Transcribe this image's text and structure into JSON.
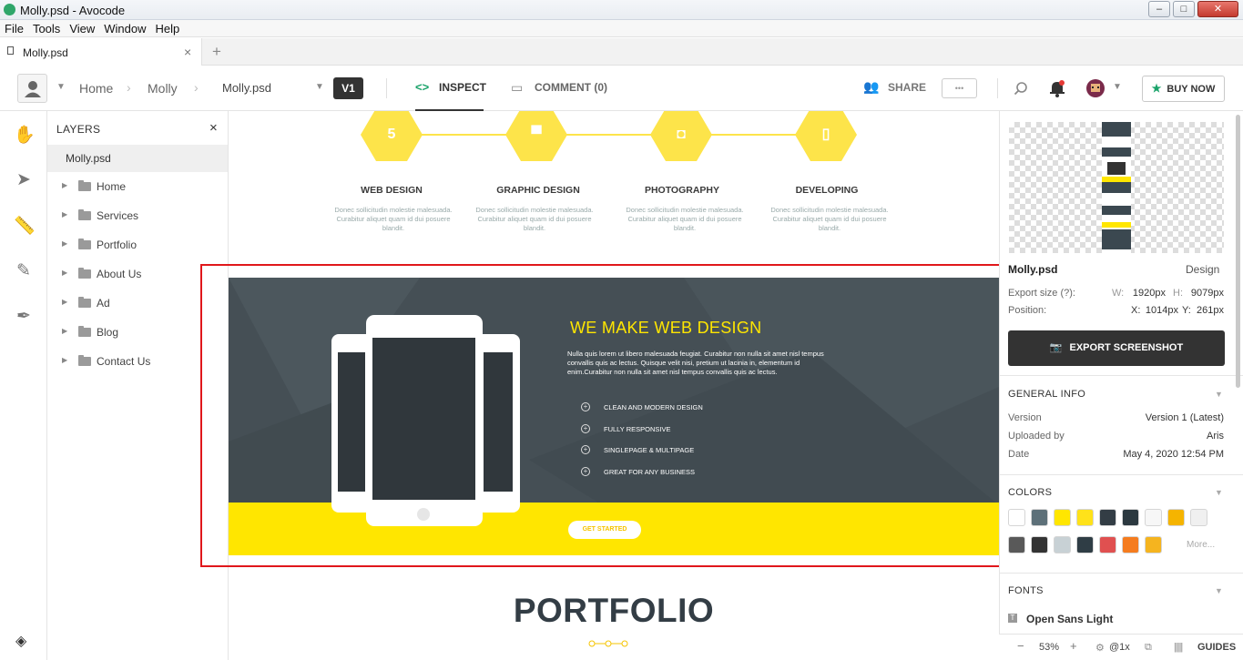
{
  "window": {
    "title": "Molly.psd - Avocode",
    "minimize": "–",
    "maximize": "□",
    "close": "✕"
  },
  "menu": [
    "File",
    "Tools",
    "View",
    "Window",
    "Help"
  ],
  "tab": {
    "label": "Molly.psd",
    "close": "×",
    "new": "+"
  },
  "toolbar": {
    "breadcrumb": [
      "Home",
      "Molly",
      "Molly.psd"
    ],
    "version": "V1",
    "inspect": "INSPECT",
    "comment": "COMMENT (0)",
    "share": "SHARE",
    "more": "•••",
    "buy_now": "BUY NOW"
  },
  "layers": {
    "header": "LAYERS",
    "close": "×",
    "root": "Molly.psd",
    "items": [
      "Home",
      "Services",
      "Portfolio",
      "About Us",
      "Ad",
      "Blog",
      "Contact Us"
    ]
  },
  "canvas": {
    "services": [
      {
        "icon": "html5-icon",
        "glyph": "5",
        "title": "WEB DESIGN",
        "desc": "Donec sollicitudin molestie malesuada. Curabitur aliquet quam id dui posuere blandit."
      },
      {
        "icon": "roller-icon",
        "glyph": "▀",
        "title": "GRAPHIC DESIGN",
        "desc": "Donec sollicitudin molestie malesuada. Curabitur aliquet quam id dui posuere blandit."
      },
      {
        "icon": "camera-icon",
        "glyph": "◘",
        "title": "PHOTOGRAPHY",
        "desc": "Donec sollicitudin molestie malesuada. Curabitur aliquet quam id dui posuere blandit."
      },
      {
        "icon": "mobile-icon",
        "glyph": "▯",
        "title": "DEVELOPING",
        "desc": "Donec sollicitudin molestie malesuada. Curabitur aliquet quam id dui posuere blandit."
      }
    ],
    "banner": {
      "title": "WE MAKE WEB DESIGN",
      "text": "Nulla quis lorem ut libero malesuada feugiat. Curabitur non nulla sit amet nisl tempus convallis quis ac lectus. Quisque velit nisi, pretium ut lacinia in, elementum id enim.Curabitur non nulla sit amet nisl tempus convallis quis ac lectus.",
      "features": [
        "CLEAN AND MODERN DESIGN",
        "FULLY RESPONSIVE",
        "SINGLEPAGE & MULTIPAGE",
        "GREAT FOR ANY BUSINESS"
      ],
      "cta": "GET STARTED"
    },
    "portfolio_title": "PORTFOLIO"
  },
  "panel": {
    "file_name": "Molly.psd",
    "file_type": "Design",
    "export_size_label": "Export size (?):",
    "w_label": "W:",
    "w_value": "1920px",
    "h_label": "H:",
    "h_value": "9079px",
    "position_label": "Position:",
    "x_label": "X:",
    "x_value": "1014px",
    "y_label": "Y:",
    "y_value": "261px",
    "export_button": "EXPORT SCREENSHOT",
    "general_info": "GENERAL INFO",
    "version_label": "Version",
    "version_value": "Version 1 (Latest)",
    "uploaded_label": "Uploaded by",
    "uploaded_value": "Aris",
    "date_label": "Date",
    "date_value": "May 4, 2020 12:54 PM",
    "colors_header": "COLORS",
    "colors_row1": [
      "#ffffff",
      "#5d7079",
      "#ffe600",
      "#ffe21a",
      "#333d45",
      "#2c3940",
      "#f7f7f7",
      "#f5b400",
      "#f0f0f0"
    ],
    "colors_row2": [
      "#595959",
      "#333333",
      "#c8d1d5",
      "#2f3d45",
      "#e05050",
      "#f57c1f",
      "#f5b41f"
    ],
    "colors_more": "More...",
    "fonts_header": "FONTS",
    "font_name": "Open Sans Light",
    "zoom": "53%",
    "scale": "@1x",
    "guides": "GUIDES"
  }
}
